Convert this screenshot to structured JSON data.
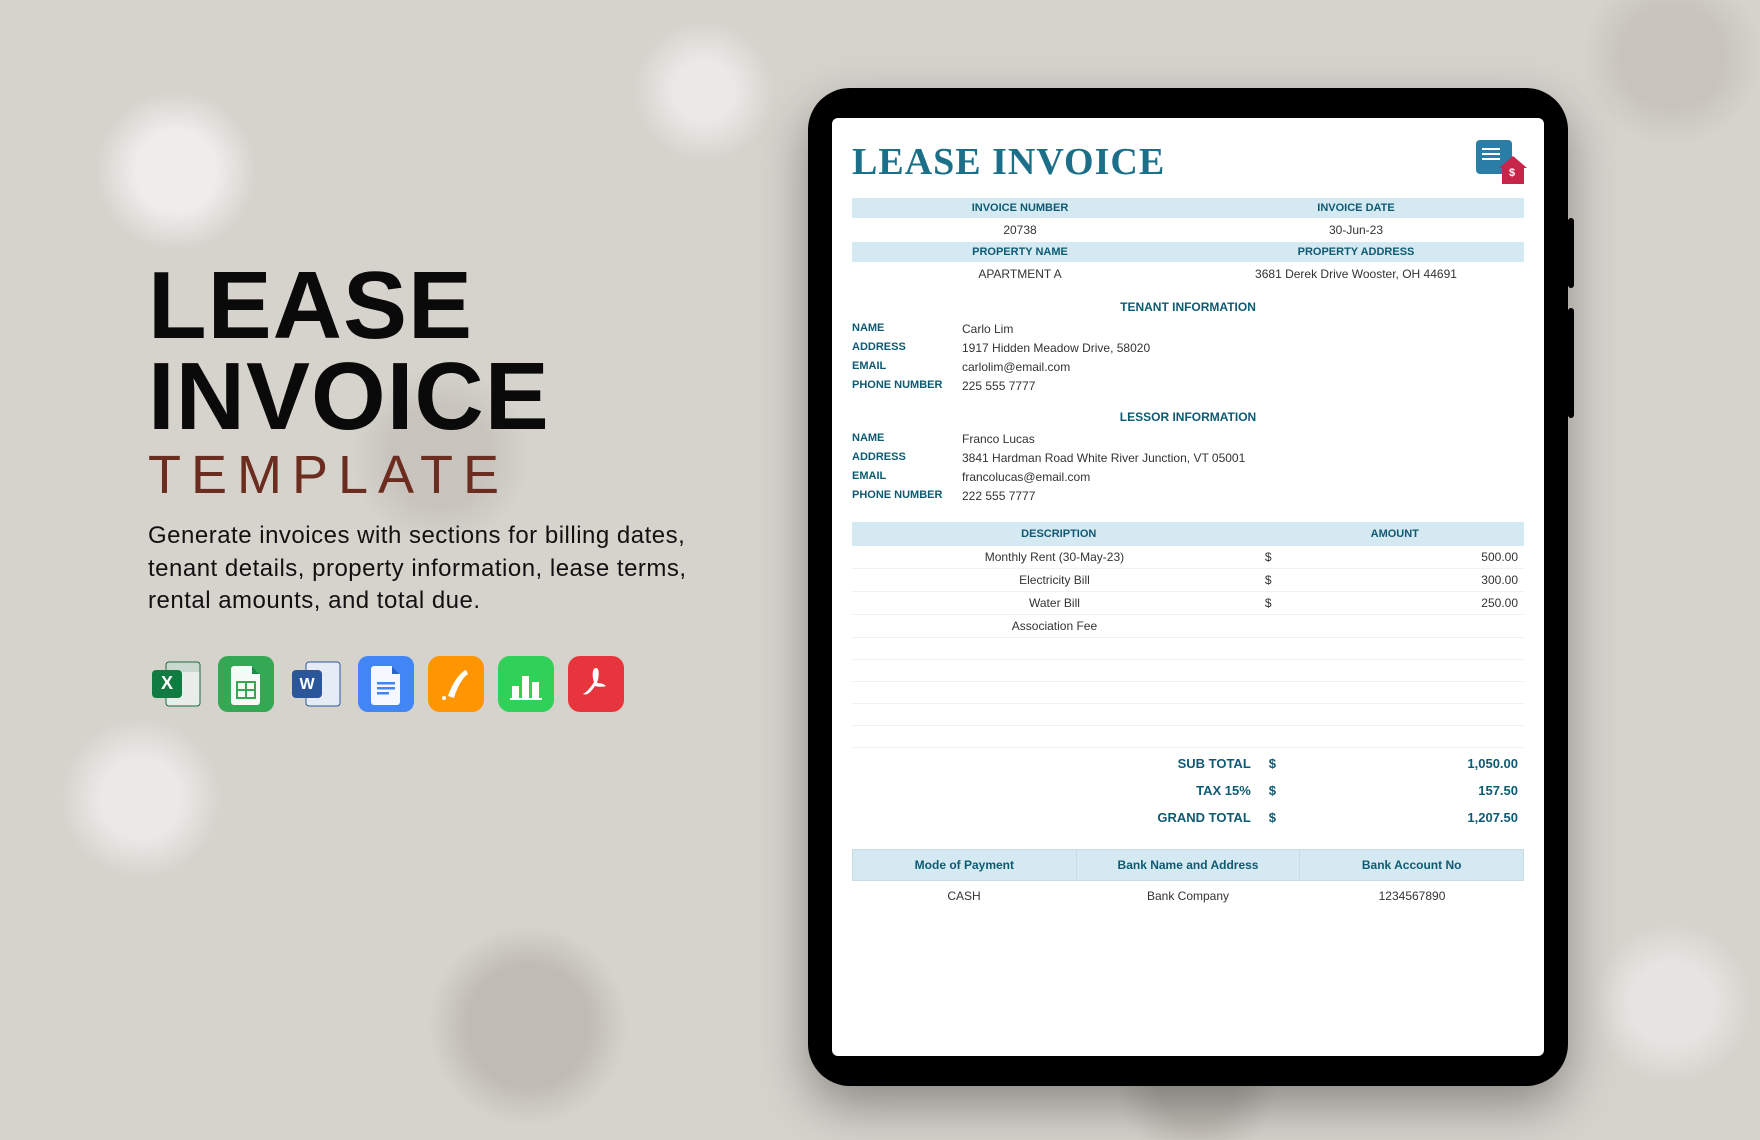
{
  "hero": {
    "title_line1": "LEASE",
    "title_line2": "INVOICE",
    "subtitle": "TEMPLATE",
    "description": "Generate invoices with sections for billing dates, tenant details, property information, lease terms, rental amounts, and total due."
  },
  "formats": [
    "excel",
    "google-sheets",
    "word",
    "google-docs",
    "pages",
    "numbers",
    "pdf"
  ],
  "doc": {
    "title": "LEASE INVOICE",
    "meta": {
      "invoice_number_label": "INVOICE NUMBER",
      "invoice_number": "20738",
      "invoice_date_label": "INVOICE DATE",
      "invoice_date": "30-Jun-23",
      "property_name_label": "PROPERTY NAME",
      "property_name": "APARTMENT A",
      "property_address_label": "PROPERTY ADDRESS",
      "property_address": "3681 Derek Drive Wooster, OH 44691"
    },
    "tenant": {
      "heading": "TENANT INFORMATION",
      "name_label": "NAME",
      "name": "Carlo Lim",
      "address_label": "ADDRESS",
      "address": "1917 Hidden Meadow Drive, 58020",
      "email_label": "EMAIL",
      "email": "carlolim@email.com",
      "phone_label": "PHONE NUMBER",
      "phone": "225 555 7777"
    },
    "lessor": {
      "heading": "LESSOR INFORMATION",
      "name_label": "NAME",
      "name": "Franco Lucas",
      "address_label": "ADDRESS",
      "address": "3841 Hardman Road White River Junction, VT 05001",
      "email_label": "EMAIL",
      "email": "francolucas@email.com",
      "phone_label": "PHONE NUMBER",
      "phone": "222 555 7777"
    },
    "items": {
      "description_label": "DESCRIPTION",
      "amount_label": "AMOUNT",
      "currency": "$",
      "rows": [
        {
          "desc": "Monthly Rent (30-May-23)",
          "amount": "500.00"
        },
        {
          "desc": "Electricity Bill",
          "amount": "300.00"
        },
        {
          "desc": "Water Bill",
          "amount": "250.00"
        },
        {
          "desc": "Association Fee",
          "amount": ""
        }
      ]
    },
    "totals": {
      "subtotal_label": "SUB TOTAL",
      "subtotal": "1,050.00",
      "tax_label": "TAX 15%",
      "tax": "157.50",
      "grand_label": "GRAND TOTAL",
      "grand": "1,207.50",
      "currency": "$"
    },
    "payment": {
      "mode_label": "Mode of Payment",
      "mode": "CASH",
      "bank_label": "Bank Name and Address",
      "bank": "Bank Company",
      "acct_label": "Bank Account No",
      "acct": "1234567890"
    }
  }
}
